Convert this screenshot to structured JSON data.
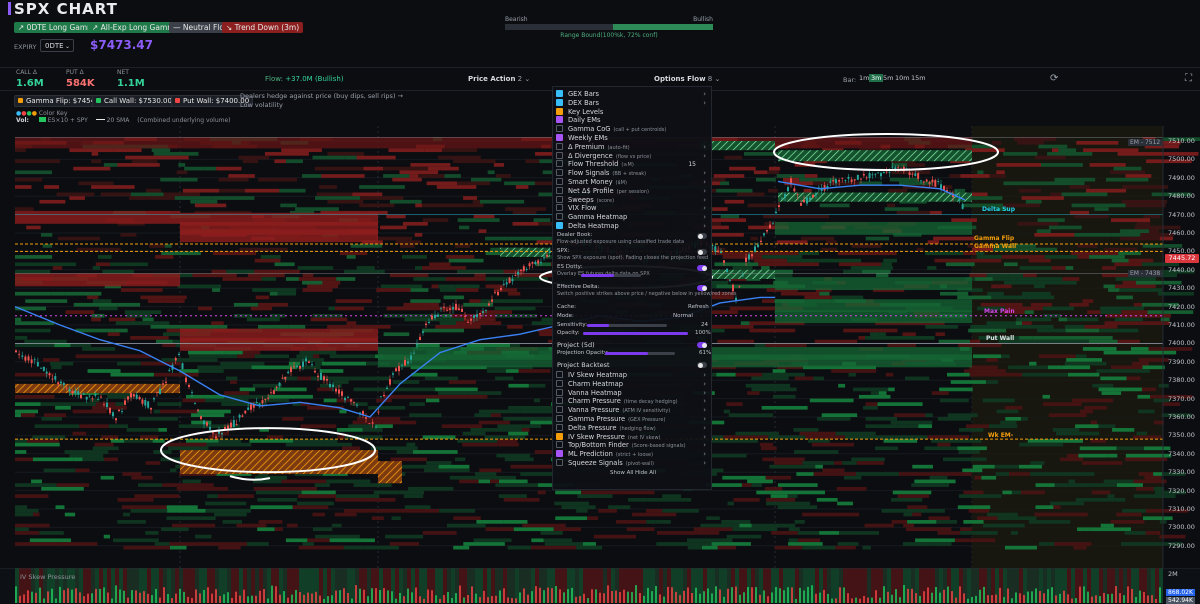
{
  "header": {
    "title": "SPX CHART",
    "chips": [
      {
        "label": "0DTE Long Gamma",
        "color": "#1f7a4a",
        "icon": "arrow-up-icon"
      },
      {
        "label": "All-Exp Long Gamma",
        "color": "#1f7a4a",
        "icon": "arrow-up-icon"
      },
      {
        "label": "Neutral Flow",
        "color": "#3a3f48",
        "icon": "dash-icon"
      },
      {
        "label": "Trend Down (3m)",
        "color": "#8b1e1e",
        "icon": "arrow-down-icon"
      }
    ],
    "sentiment": {
      "bearish": "Bearish",
      "bullish": "Bullish",
      "caption": "Range Bound(100%k, 72% conf)",
      "bull_fraction": 0.48
    },
    "expiry_label": "EXPIRY",
    "expiry_value": "0DTE",
    "price": "$7473.47",
    "stats": [
      {
        "label": "CALL Δ",
        "value": "1.6M",
        "color": "#34d399"
      },
      {
        "label": "PUT Δ",
        "value": "584K",
        "color": "#f87171"
      },
      {
        "label": "NET",
        "value": "1.1M",
        "color": "#34d399"
      }
    ]
  },
  "toolbar": {
    "flow_label": "Flow:",
    "flow_value": "+37.0M",
    "flow_state": "(Bullish)",
    "price_action": "Price Action",
    "price_action_count": "2",
    "options_flow": "Options Flow",
    "options_flow_count": "8",
    "bar_label": "Bar:",
    "bar_options": [
      "1m",
      "3m",
      "5m",
      "10m",
      "15m"
    ],
    "bar_selected": "3m"
  },
  "levels": [
    {
      "label": "Gamma Flip: $7454.31",
      "color": "#f59e0b"
    },
    {
      "label": "Call Wall: $7530.00",
      "color": "#22c55e"
    },
    {
      "label": "Put Wall: $7400.00",
      "color": "#ef4444"
    }
  ],
  "note": "Dealers hedge against price (buy dips, sell rips) → Low volatility",
  "legend": {
    "color_key": "Color Key",
    "vol_label": "Vol:",
    "es_label": "ES×10 + SPY",
    "sma_label": "20 SMA",
    "combined": "(Combined underlying volume)"
  },
  "panel": {
    "items": [
      {
        "label": "GEX Bars",
        "state": "on",
        "chev": true
      },
      {
        "label": "DEX Bars",
        "state": "on",
        "chev": true
      },
      {
        "label": "Key Levels",
        "state": "orange",
        "chev": false
      },
      {
        "label": "Daily EMs",
        "state": "purple",
        "chev": false
      },
      {
        "label": "Gamma CoG",
        "sub": "(call + put centroids)",
        "state": "off",
        "chev": false
      },
      {
        "label": "Weekly EMs",
        "state": "purple",
        "chev": false
      },
      {
        "label": "Δ Premium",
        "sub": "(auto-fit)",
        "state": "off",
        "chev": true
      },
      {
        "label": "Δ Divergence",
        "sub": "(flow vs price)",
        "state": "off",
        "chev": true
      },
      {
        "label": "Flow Threshold",
        "sub": "(≥M)",
        "state": "off",
        "num": "15"
      },
      {
        "label": "Flow Signals",
        "sub": "(BB + streak)",
        "state": "off",
        "chev": true
      },
      {
        "label": "Smart Money",
        "sub": "($M)",
        "state": "off",
        "chev": true
      },
      {
        "label": "Net Δ$ Profile",
        "sub": "(per session)",
        "state": "off",
        "chev": true
      },
      {
        "label": "Sweeps",
        "sub": "(score)",
        "state": "off",
        "chev": true
      },
      {
        "label": "VIX Flow",
        "state": "off",
        "chev": true
      },
      {
        "label": "Gamma Heatmap",
        "state": "off",
        "chev": true
      },
      {
        "label": "Delta Heatmap",
        "state": "on",
        "chev": true
      }
    ],
    "dealer_book": "Dealer Book:",
    "dealer_book_sub": "Flow-adjusted exposure using classified trade data",
    "spx": "SPX:",
    "spx_sub": "Show SPX exposure (spot). Fading closes the projection feed",
    "es_dotty": "ES Dotty:",
    "es_dotty_sub": "Overlay ES futures delta data on SPX",
    "effective_delta": "Effective Delta:",
    "effective_delta_sub": "Switch positive strikes above price / negative below in yellow/red zones",
    "cache": "Cache:",
    "refresh": "Refresh",
    "mode": "Mode:",
    "mode_value": "Normal",
    "sensitivity": "Sensitivity:",
    "sensitivity_value": "24",
    "opacity": "Opacity:",
    "opacity_value": "100%",
    "project": "Project (5d)",
    "projection_opacity": "Projection Opacity:",
    "projection_opacity_value": "61%",
    "project_backtest": "Project Backtest",
    "items2": [
      {
        "label": "IV Skew Heatmap",
        "state": "off"
      },
      {
        "label": "Charm Heatmap",
        "state": "off"
      },
      {
        "label": "Vanna Heatmap",
        "state": "off"
      },
      {
        "label": "Charm Pressure",
        "sub": "(time decay hedging)",
        "state": "off"
      },
      {
        "label": "Vanna Pressure",
        "sub": "(ATM IV sensitivity)",
        "state": "off"
      },
      {
        "label": "Gamma Pressure",
        "sub": "(GEX Pressure)",
        "state": "off"
      },
      {
        "label": "Delta Pressure",
        "sub": "(hedging flow)",
        "state": "off"
      },
      {
        "label": "IV Skew Pressure",
        "sub": "(net IV skew)",
        "state": "orange"
      },
      {
        "label": "Top/Bottom Finder",
        "sub": "(Score-based signals)",
        "state": "off"
      },
      {
        "label": "ML Prediction",
        "sub": "(strict + loose)",
        "state": "purple"
      },
      {
        "label": "Squeeze Signals",
        "sub": "(pivot-wall)",
        "state": "off"
      }
    ],
    "show_all": "Show All",
    "hide_all": "Hide All"
  },
  "price_axis": [
    "7510.00",
    "7500.00",
    "7490.00",
    "7480.00",
    "7470.00",
    "7460.00",
    "7450.00",
    "7440.00",
    "7430.00",
    "7420.00",
    "7410.00",
    "7400.00",
    "7390.00",
    "7380.00",
    "7370.00",
    "7360.00",
    "7350.00",
    "7340.00",
    "7330.00",
    "7320.00",
    "7310.00",
    "7300.00",
    "7290.00"
  ],
  "price_tag": "7445.72",
  "level_tags": [
    {
      "label": "EM - 7512",
      "color": "#9aa0aa"
    },
    {
      "label": "Delta Sup",
      "color": "#22d3ee"
    },
    {
      "label": "Gamma Flip",
      "color": "#f59e0b"
    },
    {
      "label": "Gamma Wall",
      "color": "#f59e0b"
    },
    {
      "label": "EM - 7438",
      "color": "#9aa0aa"
    },
    {
      "label": "Max Pain",
      "color": "#d946ef"
    },
    {
      "label": "Put Wall",
      "color": "#e5e7eb"
    },
    {
      "label": "Wk EM-",
      "color": "#f59e0b"
    }
  ],
  "bottom": {
    "label": "IV Skew Pressure",
    "vol_top": "2M",
    "vol_value": "868.02K",
    "vol_value2": "542.94K"
  }
}
